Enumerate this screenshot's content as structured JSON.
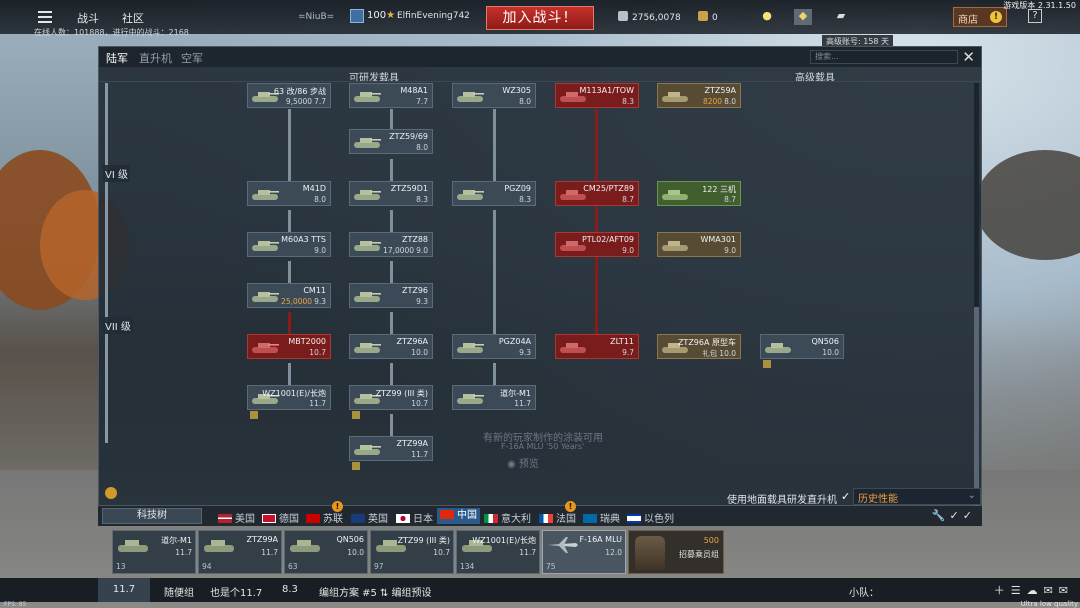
{
  "topbar": {
    "nav_battle": "战斗",
    "nav_community": "社区",
    "online_text": "在线人数：101888，进行中的战斗：2168",
    "squad_tag": "=NiuB=",
    "player_level": "100",
    "player_name": "ElfinEvening742",
    "join_battle": "加入战斗！",
    "silver_lions": "2756,0078",
    "eagles": "0",
    "shop_label": "商店",
    "help_label": "?",
    "version": "游戏版本 2.31.1.50",
    "premium_tooltip": "高级账号: 158 天"
  },
  "research": {
    "tabs": [
      "陆军",
      "直升机",
      "空军"
    ],
    "search_placeholder": "搜索...",
    "col_researchable": "可研发载具",
    "col_premium": "高级载具",
    "rank_vi": "VI 级",
    "rank_vii": "VII 级",
    "cards": [
      {
        "name": "63 改/86 步战",
        "rp": "9,5000",
        "br": "7.7"
      },
      {
        "name": "M48A1",
        "br": "7.7"
      },
      {
        "name": "WZ305",
        "br": "8.0"
      },
      {
        "name": "M113A1/TOW",
        "br": "8.3"
      },
      {
        "name": "ZTZ59A",
        "gp": "8200",
        "br": "8.0"
      },
      {
        "name": "ZTZ59/69",
        "br": "8.0"
      },
      {
        "name": "M41D",
        "br": "8.0"
      },
      {
        "name": "ZTZ59D1",
        "br": "8.3"
      },
      {
        "name": "PGZ09",
        "br": "8.3"
      },
      {
        "name": "CM25/PTZ89",
        "br": "8.7"
      },
      {
        "name": "122 三机",
        "br": "8.7"
      },
      {
        "name": "M60A3 TTS",
        "br": "9.0"
      },
      {
        "name": "ZTZ88",
        "rp": "17,0000",
        "br": "9.0"
      },
      {
        "name": "PTL02/AFT09",
        "br": "9.0"
      },
      {
        "name": "WMA301",
        "br": "9.0"
      },
      {
        "name": "CM11",
        "gp": "25,0000",
        "br": "9.3"
      },
      {
        "name": "ZTZ96",
        "br": "9.3"
      },
      {
        "name": "MBT2000",
        "br": "10.7"
      },
      {
        "name": "ZTZ96A",
        "br": "10.0"
      },
      {
        "name": "PGZ04A",
        "br": "9.3"
      },
      {
        "name": "ZLT11",
        "br": "9.7"
      },
      {
        "name": "ZTZ96A 原型车",
        "pack": "礼包",
        "br": "10.0"
      },
      {
        "name": "QN506",
        "br": "10.0"
      },
      {
        "name": "WZ1001(E)/长炮",
        "br": "11.7"
      },
      {
        "name": "ZTZ99 (III 类)",
        "br": "10.7"
      },
      {
        "name": "道尔-M1",
        "br": "11.7"
      },
      {
        "name": "ZTZ99A",
        "br": "11.7"
      }
    ],
    "watermark_line1": "有新的玩家制作的涂装可用",
    "watermark_line2": "F-16A MLU '50 Years'",
    "watermark_preview": "预览",
    "ground_research_heli": "使用地面载具研发直升机",
    "dropdown_value": "历史性能"
  },
  "nations": {
    "techtree_label": "科技树",
    "list": [
      "美国",
      "德国",
      "苏联",
      "英国",
      "日本",
      "中国",
      "意大利",
      "法国",
      "瑞典",
      "以色列"
    ],
    "active": "中国"
  },
  "slots": [
    {
      "name": "道尔-M1",
      "br": "11.7",
      "crew": "13"
    },
    {
      "name": "ZTZ99A",
      "br": "11.7",
      "crew": "94"
    },
    {
      "name": "QN506",
      "br": "10.0",
      "crew": "63"
    },
    {
      "name": "ZTZ99 (III 类)",
      "br": "10.7",
      "crew": "97"
    },
    {
      "name": "WZ1001(E)/长炮",
      "br": "11.7",
      "crew": "134"
    },
    {
      "name": "F-16A MLU",
      "br": "12.0",
      "crew": "75"
    }
  ],
  "recruit": {
    "cost": "500",
    "label": "招募乘员组"
  },
  "bottombar": {
    "br_tab": "11.7",
    "random_group": "随便组",
    "also_br": "也是个11.7",
    "br2": "8.3",
    "preset": "编组方案 #5",
    "preset_edit": "编组预设",
    "squad": "小队："
  },
  "fps": "FPS: 85",
  "quality": "Ultra low quality",
  "colors": {
    "join_red": "#c6302a",
    "active_nation": "#2a5a8a",
    "research_red": "#7a1c1c",
    "premium_gold": "#e8a440"
  }
}
